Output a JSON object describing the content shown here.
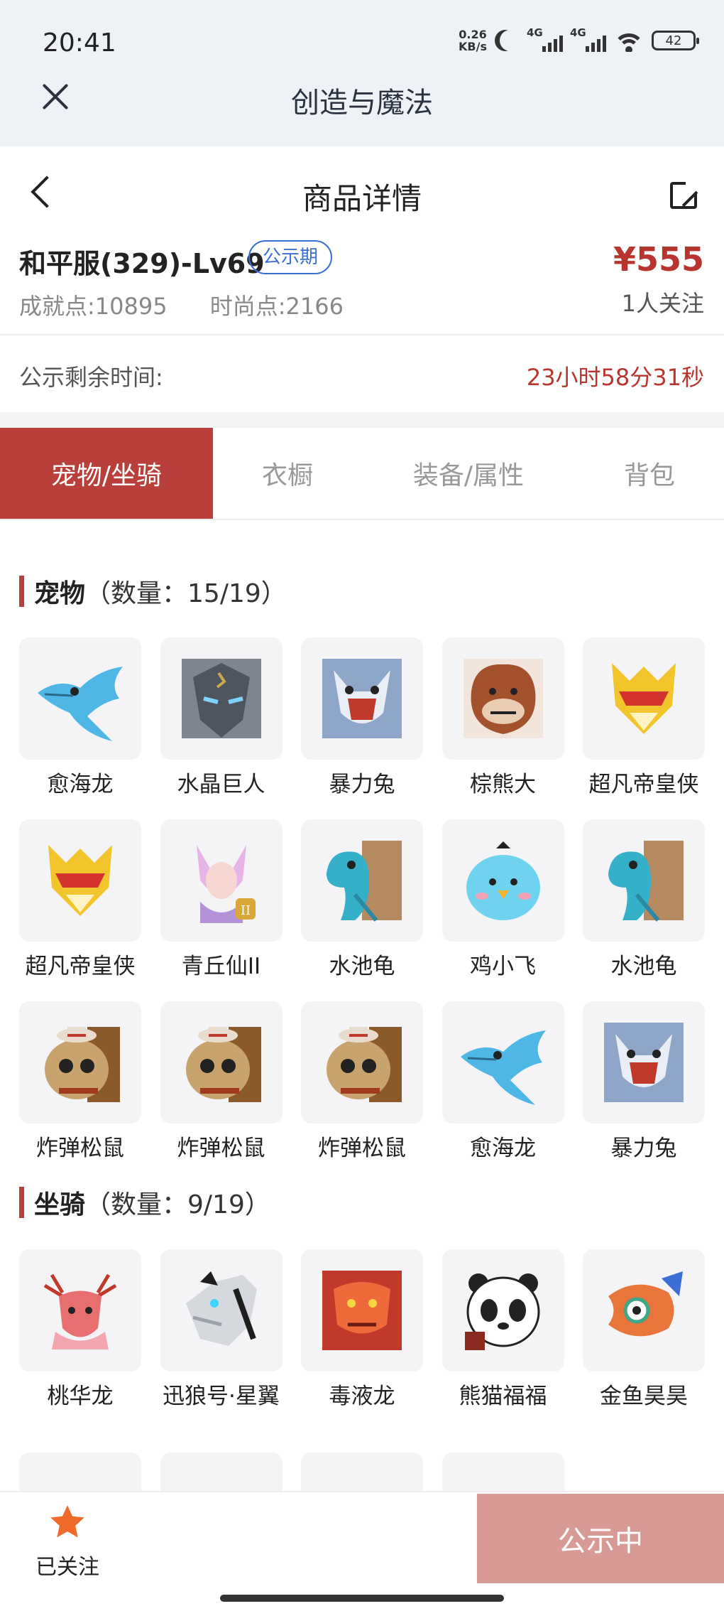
{
  "status_bar": {
    "time": "20:41",
    "net_speed_value": "0.26",
    "net_speed_unit": "KB/s",
    "signal1_label": "4G",
    "signal2_label": "4G",
    "battery": "42"
  },
  "app_bar": {
    "title": "创造与魔法"
  },
  "header": {
    "title": "商品详情"
  },
  "product": {
    "server_name": "和平服(329)-Lv69",
    "badge": "公示期",
    "achievement_points": "成就点:10895",
    "fashion_points": "时尚点:2166",
    "price": "¥555",
    "followers": "1人关注"
  },
  "remaining": {
    "label": "公示剩余时间:",
    "value": "23小时58分31秒"
  },
  "tabs": [
    {
      "label": "宠物/坐骑",
      "active": true
    },
    {
      "label": "衣橱",
      "active": false
    },
    {
      "label": "装备/属性",
      "active": false
    },
    {
      "label": "背包",
      "active": false
    }
  ],
  "pets": {
    "title": "宠物",
    "count": "（数量：15/19）",
    "items": [
      {
        "name": "愈海龙",
        "icon": "sea-dragon-icon"
      },
      {
        "name": "水晶巨人",
        "icon": "crystal-giant-icon"
      },
      {
        "name": "暴力兔",
        "icon": "violent-rabbit-icon"
      },
      {
        "name": "棕熊大",
        "icon": "brown-bear-icon"
      },
      {
        "name": "超凡帝皇侠",
        "icon": "emperor-hero-icon"
      },
      {
        "name": "超凡帝皇侠",
        "icon": "emperor-hero-icon"
      },
      {
        "name": "青丘仙II",
        "icon": "fox-fairy-icon"
      },
      {
        "name": "水池龟",
        "icon": "pond-turtle-icon"
      },
      {
        "name": "鸡小飞",
        "icon": "chick-icon"
      },
      {
        "name": "水池龟",
        "icon": "pond-turtle-icon"
      },
      {
        "name": "炸弹松鼠",
        "icon": "bomb-squirrel-icon"
      },
      {
        "name": "炸弹松鼠",
        "icon": "bomb-squirrel-icon"
      },
      {
        "name": "炸弹松鼠",
        "icon": "bomb-squirrel-icon"
      },
      {
        "name": "愈海龙",
        "icon": "sea-dragon-icon"
      },
      {
        "name": "暴力兔",
        "icon": "violent-rabbit-icon"
      }
    ]
  },
  "mounts": {
    "title": "坐骑",
    "count": "（数量：9/19）",
    "items": [
      {
        "name": "桃华龙",
        "icon": "peach-dragon-icon"
      },
      {
        "name": "迅狼号·星翼",
        "icon": "mech-wolf-icon"
      },
      {
        "name": "毒液龙",
        "icon": "venom-dragon-icon"
      },
      {
        "name": "熊猫福福",
        "icon": "panda-icon"
      },
      {
        "name": "金鱼昊昊",
        "icon": "goldfish-icon"
      }
    ]
  },
  "bottom_bar": {
    "follow_label": "已关注",
    "status_label": "公示中"
  },
  "colors": {
    "accent": "#b9403a",
    "price": "#b8352f",
    "badge": "#3b6fd6",
    "status_button": "#d89a95",
    "star": "#f06a2a"
  }
}
